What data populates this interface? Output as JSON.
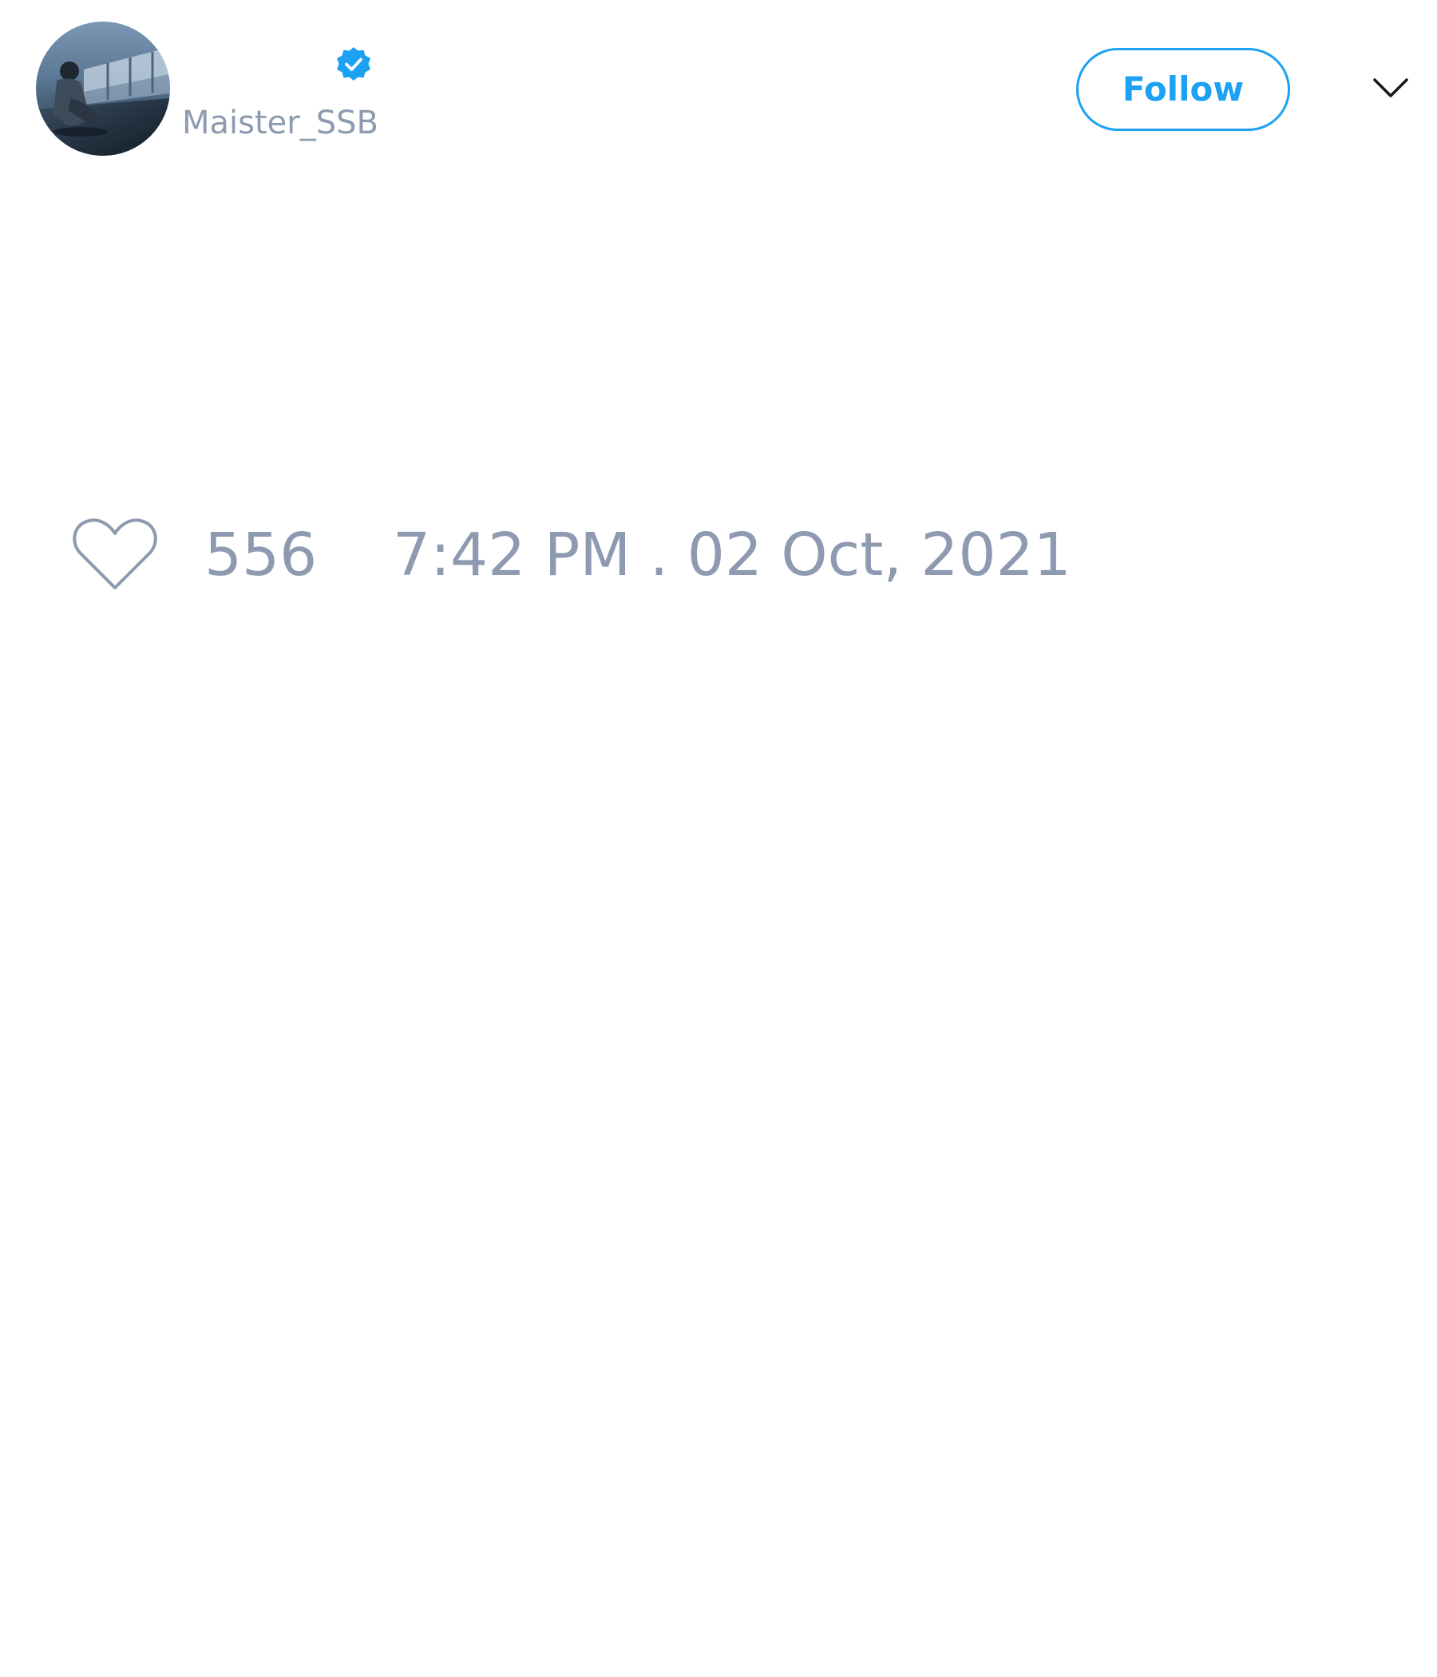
{
  "tweet": {
    "author": {
      "display_name": "",
      "handle": "Maister_SSB",
      "verified": true,
      "avatar_icon": "avatar-photo"
    },
    "actions": {
      "follow_label": "Follow",
      "menu_icon": "chevron-down-icon"
    },
    "stats": {
      "like_icon": "heart-icon",
      "like_count": "556",
      "timestamp": "7:42 PM . 02 Oct, 2021"
    }
  },
  "colors": {
    "accent": "#1da1f2",
    "muted_text": "#8d9ab0",
    "background": "#ffffff"
  }
}
